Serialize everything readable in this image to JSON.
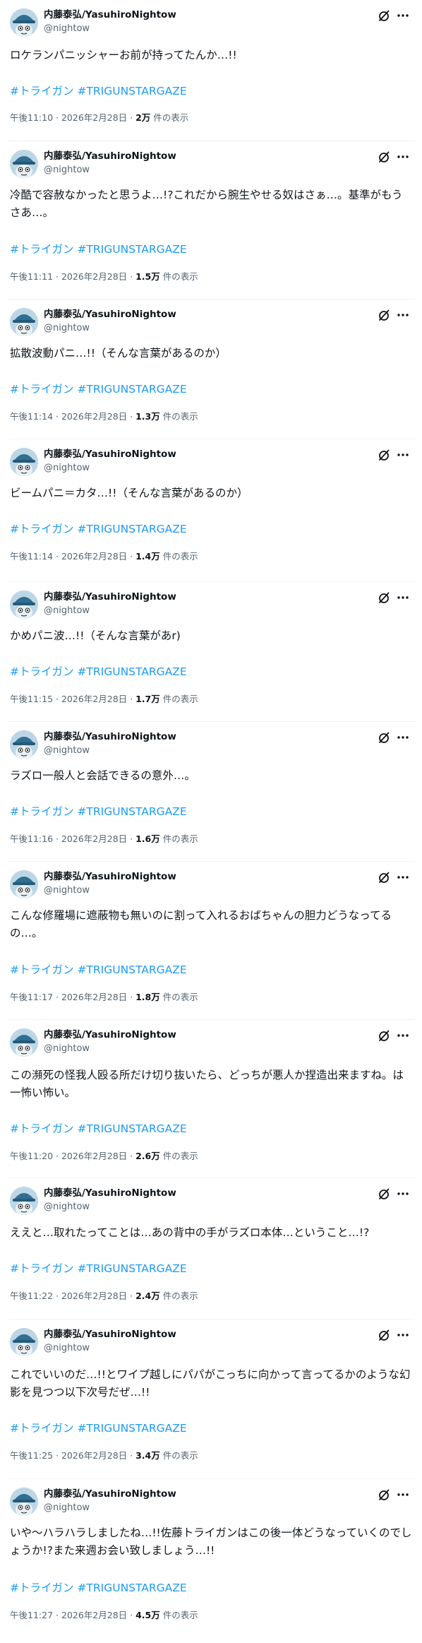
{
  "account": {
    "name": "内藤泰弘/YasuhiroNightow",
    "handle": "@nightow",
    "avatar_icon": "avatar-mascot-icon"
  },
  "ui": {
    "grok_icon": "grok-slash-circle-icon",
    "more_icon": "more-dots-icon",
    "meta_separator": "·",
    "views_suffix": "件の表示",
    "hashtag_color": "#1d9bf0"
  },
  "tweets": [
    {
      "text": "ロケランパニッシャーお前が持ってたんか…!!",
      "hashtags": [
        "#トライガン",
        "#TRIGUNSTARGAZE"
      ],
      "time": "午後11:10",
      "date": "2026年2月28日",
      "views": "2万"
    },
    {
      "text": "冷酷で容赦なかったと思うよ…!?これだから腕生やせる奴はさぁ…。基準がもうさあ…。",
      "hashtags": [
        "#トライガン",
        "#TRIGUNSTARGAZE"
      ],
      "time": "午後11:11",
      "date": "2026年2月28日",
      "views": "1.5万"
    },
    {
      "text": "拡散波動パニ…!!（そんな言葉があるのか）",
      "hashtags": [
        "#トライガン",
        "#TRIGUNSTARGAZE"
      ],
      "time": "午後11:14",
      "date": "2026年2月28日",
      "views": "1.3万"
    },
    {
      "text": "ビームパニ＝カタ…!!（そんな言葉があるのか）",
      "hashtags": [
        "#トライガン",
        "#TRIGUNSTARGAZE"
      ],
      "time": "午後11:14",
      "date": "2026年2月28日",
      "views": "1.4万"
    },
    {
      "text": "かめパニ波…!!（そんな言葉があr)",
      "hashtags": [
        "#トライガン",
        "#TRIGUNSTARGAZE"
      ],
      "time": "午後11:15",
      "date": "2026年2月28日",
      "views": "1.7万"
    },
    {
      "text": "ラズロ一般人と会話できるの意外…。",
      "hashtags": [
        "#トライガン",
        "#TRIGUNSTARGAZE"
      ],
      "time": "午後11:16",
      "date": "2026年2月28日",
      "views": "1.6万"
    },
    {
      "text": "こんな修羅場に遮蔽物も無いのに割って入れるおばちゃんの胆力どうなってるの…。",
      "hashtags": [
        "#トライガン",
        "#TRIGUNSTARGAZE"
      ],
      "time": "午後11:17",
      "date": "2026年2月28日",
      "views": "1.8万"
    },
    {
      "text": "この瀕死の怪我人殴る所だけ切り抜いたら、どっちが悪人か捏造出来ますね。は一怖い怖い。",
      "hashtags": [
        "#トライガン",
        "#TRIGUNSTARGAZE"
      ],
      "time": "午後11:20",
      "date": "2026年2月28日",
      "views": "2.6万"
    },
    {
      "text": "ええと…取れたってことは…あの背中の手がラズロ本体…ということ…!?",
      "hashtags": [
        "#トライガン",
        "#TRIGUNSTARGAZE"
      ],
      "time": "午後11:22",
      "date": "2026年2月28日",
      "views": "2.4万"
    },
    {
      "text": "これでいいのだ…!!とワイプ越しにパパがこっちに向かって言ってるかのような幻影を見つつ以下次号だぜ…!!",
      "hashtags": [
        "#トライガン",
        "#TRIGUNSTARGAZE"
      ],
      "time": "午後11:25",
      "date": "2026年2月28日",
      "views": "3.4万"
    },
    {
      "text": "いや〜ハラハラしましたね…!!佐藤トライガンはこの後一体どうなっていくのでしょうか!?また来週お会い致しましょう…!!",
      "hashtags": [
        "#トライガン",
        "#TRIGUNSTARGAZE"
      ],
      "time": "午後11:27",
      "date": "2026年2月28日",
      "views": "4.5万"
    }
  ]
}
